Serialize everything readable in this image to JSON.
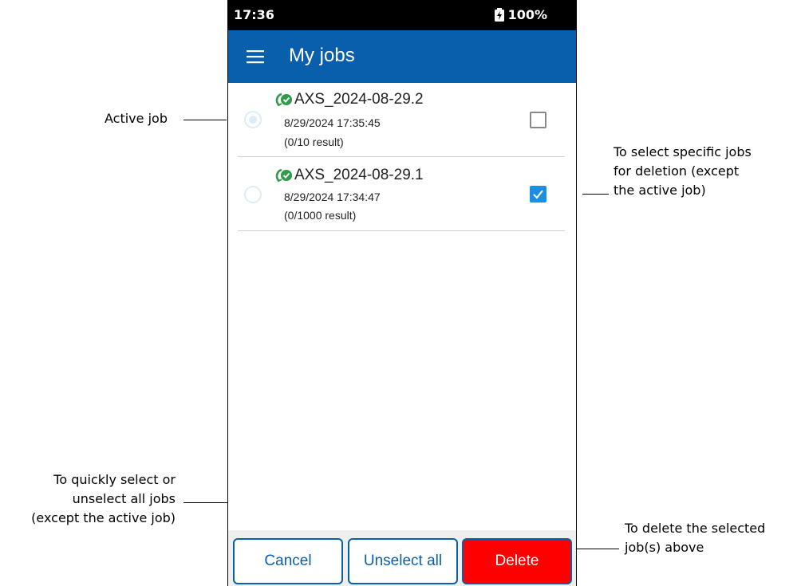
{
  "status_bar": {
    "time": "17:36",
    "battery": "100%"
  },
  "app_bar": {
    "title": "My jobs",
    "menu_icon": "hamburger-menu-icon"
  },
  "jobs": [
    {
      "name": "AXS_2024-08-29.2",
      "date": "8/29/2024 17:35:45",
      "results": "(0/10 result)",
      "active": true,
      "selected": false
    },
    {
      "name": "AXS_2024-08-29.1",
      "date": "8/29/2024 17:34:47",
      "results": "(0/1000 result)",
      "active": false,
      "selected": true
    }
  ],
  "buttons": {
    "cancel": "Cancel",
    "unselect_all": "Unselect all",
    "delete": "Delete"
  },
  "annotations": {
    "active_job": "Active job",
    "select_specific": [
      "To select specific jobs",
      "for deletion (except",
      "the active job)"
    ],
    "select_all": [
      "To quickly select or",
      "unselect all jobs",
      "(except the active job)"
    ],
    "delete_selected": [
      "To delete the selected",
      "job(s) above"
    ]
  },
  "colors": {
    "app_bar": "#0a5fad",
    "delete_button": "#ff0000",
    "checkbox_checked": "#1e8fe0",
    "sync_icon": "#2e9a4a"
  }
}
